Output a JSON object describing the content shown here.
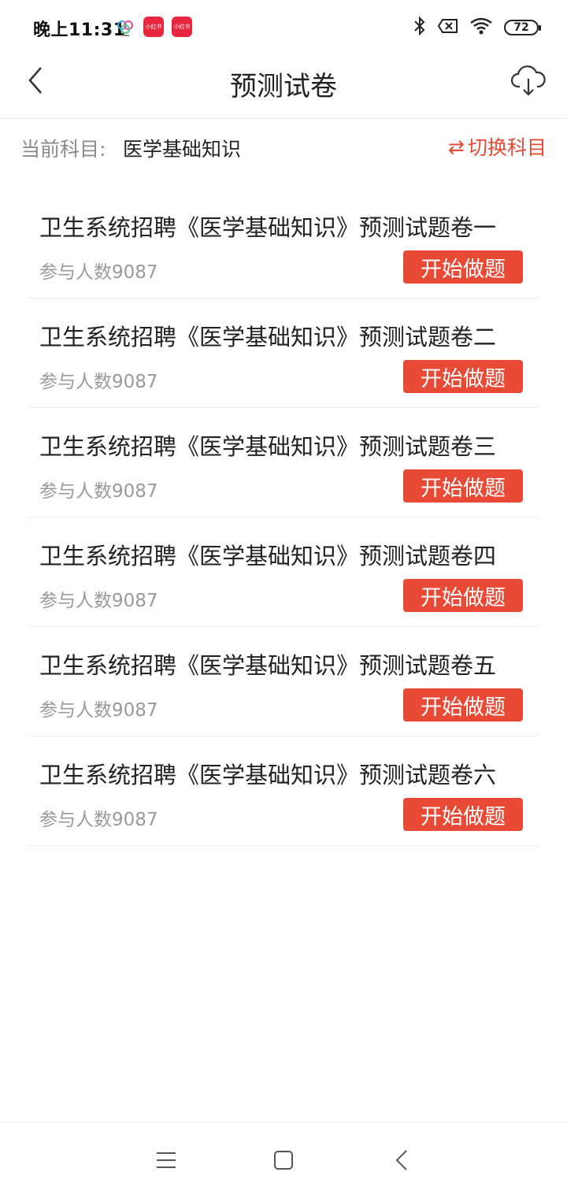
{
  "status_bar": {
    "time": "晚上11:31",
    "app_icon_label_2": "小红书",
    "app_icon_label_3": "小红书",
    "battery": "72"
  },
  "header": {
    "title": "预测试卷"
  },
  "subject": {
    "label": "当前科目:",
    "value": "医学基础知识",
    "switch_label": "切换科目"
  },
  "papers": [
    {
      "title": "卫生系统招聘《医学基础知识》预测试题卷一",
      "participants": "参与人数9087",
      "button": "开始做题"
    },
    {
      "title": "卫生系统招聘《医学基础知识》预测试题卷二",
      "participants": "参与人数9087",
      "button": "开始做题"
    },
    {
      "title": "卫生系统招聘《医学基础知识》预测试题卷三",
      "participants": "参与人数9087",
      "button": "开始做题"
    },
    {
      "title": "卫生系统招聘《医学基础知识》预测试题卷四",
      "participants": "参与人数9087",
      "button": "开始做题"
    },
    {
      "title": "卫生系统招聘《医学基础知识》预测试题卷五",
      "participants": "参与人数9087",
      "button": "开始做题"
    },
    {
      "title": "卫生系统招聘《医学基础知识》预测试题卷六",
      "participants": "参与人数9087",
      "button": "开始做题"
    }
  ],
  "colors": {
    "accent": "#e84a36",
    "text_primary": "#222222",
    "text_secondary": "#9a9a9a"
  }
}
